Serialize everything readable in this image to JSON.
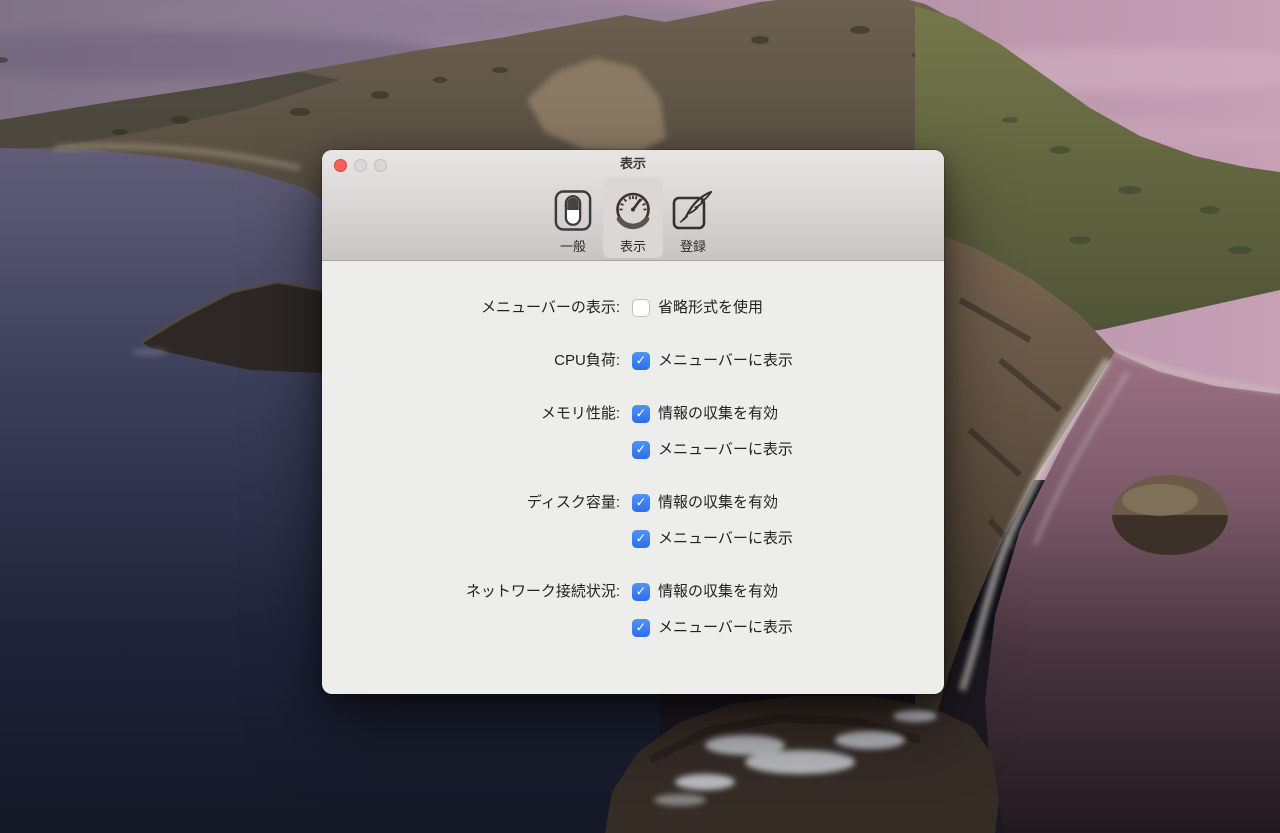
{
  "window": {
    "title": "表示",
    "traffic_lights": {
      "close": "close",
      "minimize": "minimize",
      "zoom": "zoom"
    },
    "toolbar": {
      "items": [
        {
          "label": "一般",
          "icon": "toggle-switch-icon",
          "selected": false
        },
        {
          "label": "表示",
          "icon": "gauge-icon",
          "selected": true
        },
        {
          "label": "登録",
          "icon": "register-pen-icon",
          "selected": false
        }
      ]
    },
    "settings": {
      "sections": [
        {
          "label": "メニューバーの表示:",
          "items": [
            {
              "text": "省略形式を使用",
              "checked": false
            }
          ]
        },
        {
          "label": "CPU負荷:",
          "items": [
            {
              "text": "メニューバーに表示",
              "checked": true
            }
          ]
        },
        {
          "label": "メモリ性能:",
          "items": [
            {
              "text": "情報の収集を有効",
              "checked": true
            },
            {
              "text": "メニューバーに表示",
              "checked": true
            }
          ]
        },
        {
          "label": "ディスク容量:",
          "items": [
            {
              "text": "情報の収集を有効",
              "checked": true
            },
            {
              "text": "メニューバーに表示",
              "checked": true
            }
          ]
        },
        {
          "label": "ネットワーク接続状況:",
          "items": [
            {
              "text": "情報の収集を有効",
              "checked": true
            },
            {
              "text": "メニューバーに表示",
              "checked": true
            }
          ]
        }
      ]
    }
  },
  "colors": {
    "checkbox_accent": "#347cf2",
    "close_button": "#f4605a",
    "window_content_bg": "#ededec",
    "header_top": "#e8e6e5",
    "header_bottom": "#c8c5c3",
    "selected_tab_bg": "#dad7d5",
    "sky_pink": "#c7a0b6",
    "water_left_navy": "#20243a",
    "water_right_maroon": "#7c5a6a"
  }
}
